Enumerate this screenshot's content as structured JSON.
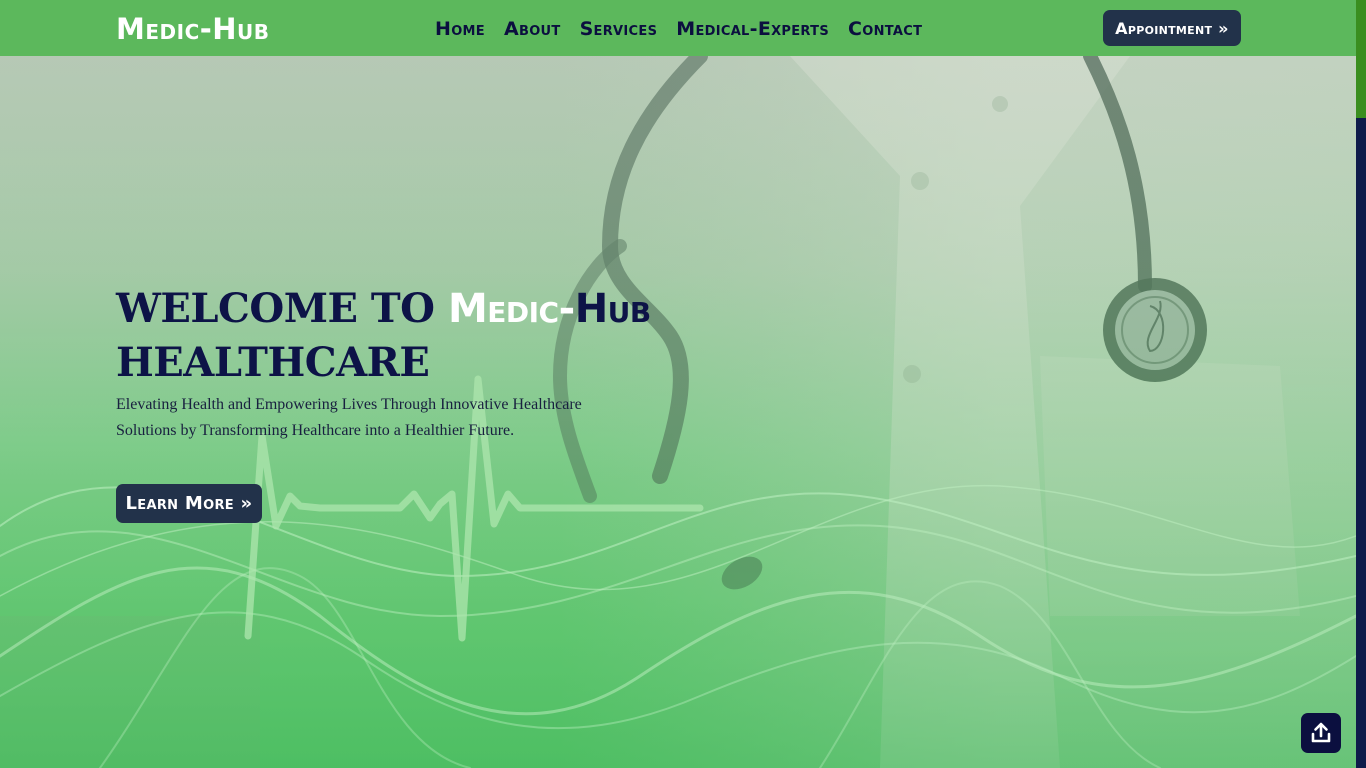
{
  "header": {
    "logo": "Medic-Hub",
    "nav": [
      {
        "label": "Home"
      },
      {
        "label": "About"
      },
      {
        "label": "Services"
      },
      {
        "label": "Medical-Experts"
      },
      {
        "label": "Contact"
      }
    ],
    "appointment_label": "Appointment »"
  },
  "hero": {
    "title_prefix": "WELCOME TO ",
    "brand_part1": "Medic-",
    "brand_part2": "Hub",
    "title_suffix": "HEALTHCARE",
    "subtitle": "Elevating Health and Empowering Lives Through Innovative Healthcare Solutions by Transforming Healthcare into a Healthier Future.",
    "cta_label": "Learn More »"
  },
  "icons": {
    "back_to_top": "upload-arrow-icon"
  },
  "colors": {
    "header_bg": "#5cb85c",
    "nav_text": "#0b0f3f",
    "button_bg": "#22324a",
    "title_text": "#0d1347",
    "scrollbar_track": "#0e1a4a",
    "scrollbar_thumb": "#3a8e1f"
  }
}
